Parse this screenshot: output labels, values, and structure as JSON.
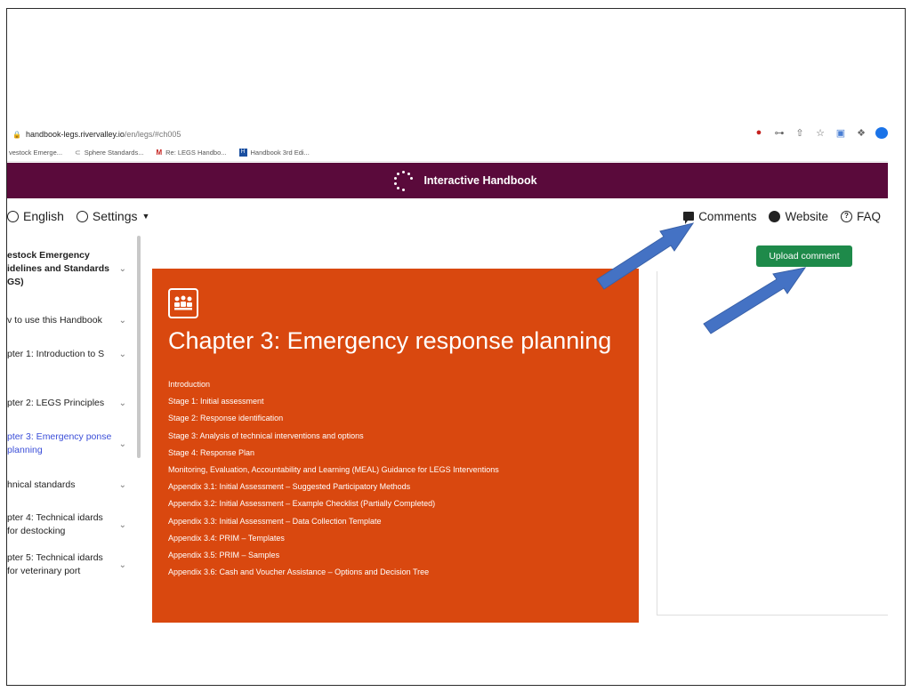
{
  "browser": {
    "url_host": "handbook-legs.rivervalley.io",
    "url_path": "/en/legs/#ch005",
    "bookmarks": [
      {
        "icon": "chrome-icon",
        "label": "vestock Emerge..."
      },
      {
        "icon": "sphere-icon",
        "label": "Sphere Standards..."
      },
      {
        "icon": "gmail-icon",
        "label": "Re: LEGS Handbo..."
      },
      {
        "icon": "handbook-icon",
        "label": "Handbook 3rd Edi..."
      }
    ]
  },
  "site": {
    "title": "Interactive Handbook",
    "header_color": "#5a0a3b"
  },
  "toolbar": {
    "language": "English",
    "settings": "Settings",
    "comments": "Comments",
    "website": "Website",
    "faq": "FAQ"
  },
  "sidebar": {
    "items": [
      {
        "label": "estock Emergency idelines and Standards GS)"
      },
      {
        "label": "v to use this Handbook"
      },
      {
        "label": "pter 1: Introduction to S"
      },
      {
        "label": "pter 2: LEGS Principles"
      },
      {
        "label": "pter 3: Emergency ponse planning"
      },
      {
        "label": "hnical standards"
      },
      {
        "label": "pter 4: Technical idards for destocking"
      },
      {
        "label": "pter 5: Technical idards for veterinary port"
      }
    ]
  },
  "chapter": {
    "title": "Chapter 3: Emergency response planning",
    "accent": "#d9480f",
    "links": [
      "Introduction",
      "Stage 1: Initial assessment",
      "Stage 2: Response identification",
      "Stage 3: Analysis of technical interventions and options",
      "Stage 4: Response Plan",
      "Monitoring, Evaluation, Accountability and Learning (MEAL) Guidance for LEGS Interventions",
      "Appendix 3.1: Initial Assessment – Suggested Participatory Methods",
      "Appendix 3.2: Initial Assessment – Example Checklist (Partially Completed)",
      "Appendix 3.3: Initial Assessment – Data Collection Template",
      "Appendix 3.4: PRIM – Templates",
      "Appendix 3.5: PRIM – Samples",
      "Appendix 3.6: Cash and Voucher Assistance – Options and Decision Tree"
    ]
  },
  "comments_panel": {
    "upload_label": "Upload comment",
    "button_color": "#1e8a4a"
  },
  "annotations": {
    "arrow_color": "#4472c4"
  }
}
